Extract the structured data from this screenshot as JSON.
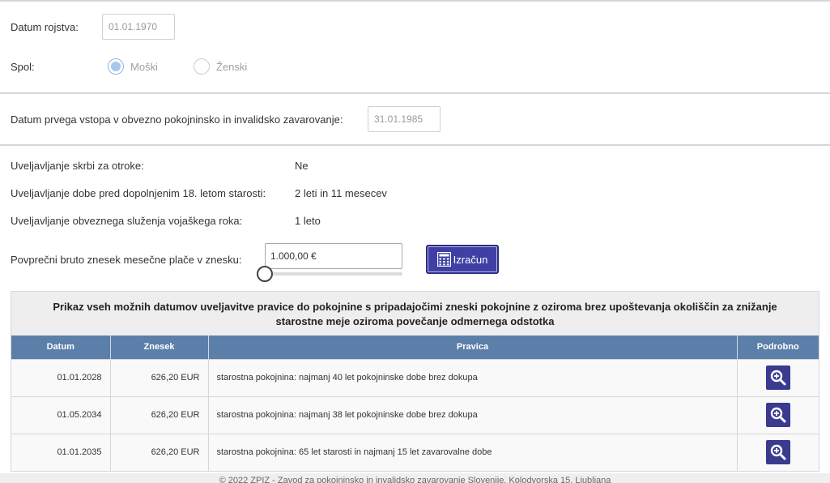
{
  "personal": {
    "birth_label": "Datum rojstva:",
    "birth_value": "01.01.1970",
    "gender_label": "Spol:",
    "gender_options": [
      "Moški",
      "Ženski"
    ]
  },
  "insurance": {
    "entry_label": "Datum prvega vstopa v obvezno pokojninsko in invalidsko zavarovanje:",
    "entry_value": "31.01.1985"
  },
  "claims": [
    {
      "label": "Uveljavljanje skrbi za otroke:",
      "value": "Ne"
    },
    {
      "label": "Uveljavljanje dobe pred dopolnjenim 18. letom starosti:",
      "value": "2 leti in 11 mesecev"
    },
    {
      "label": "Uveljavljanje obveznega služenja vojaškega roka:",
      "value": "1 leto"
    }
  ],
  "salary": {
    "label": "Povprečni bruto znesek mesečne plače v znesku:",
    "value": "1.000,00 €",
    "calc_button": "Izračun",
    "slider_level": 0
  },
  "results": {
    "title": "Prikaz vseh možnih datumov uveljavitve pravice do pokojnine s pripadajočimi zneski pokojnine z oziroma brez upoštevanja okoliščin za znižanje starostne meje oziroma povečanje odmernega odstotka",
    "columns": [
      "Datum",
      "Znesek",
      "Pravica",
      "Podrobno"
    ],
    "rows": [
      {
        "date": "01.01.2028",
        "amount": "626,20 EUR",
        "right": "starostna pokojnina: najmanj 40 let pokojninske dobe brez dokupa"
      },
      {
        "date": "01.05.2034",
        "amount": "626,20 EUR",
        "right": "starostna pokojnina: najmanj 38 let pokojninske dobe brez dokupa"
      },
      {
        "date": "01.01.2035",
        "amount": "626,20 EUR",
        "right": "starostna pokojnina: 65 let starosti in najmanj 15 let zavarovalne dobe"
      }
    ]
  },
  "footer": {
    "text": "© 2022 ZPIZ - Zavod za pokojninsko in invalidsko zavarovanje Slovenije, Kolodvorska 15, Ljubljana"
  },
  "colors": {
    "table_header": "#5b7fa8",
    "button": "#3f3fa6",
    "panel_title_bg": "#eeeeee"
  }
}
